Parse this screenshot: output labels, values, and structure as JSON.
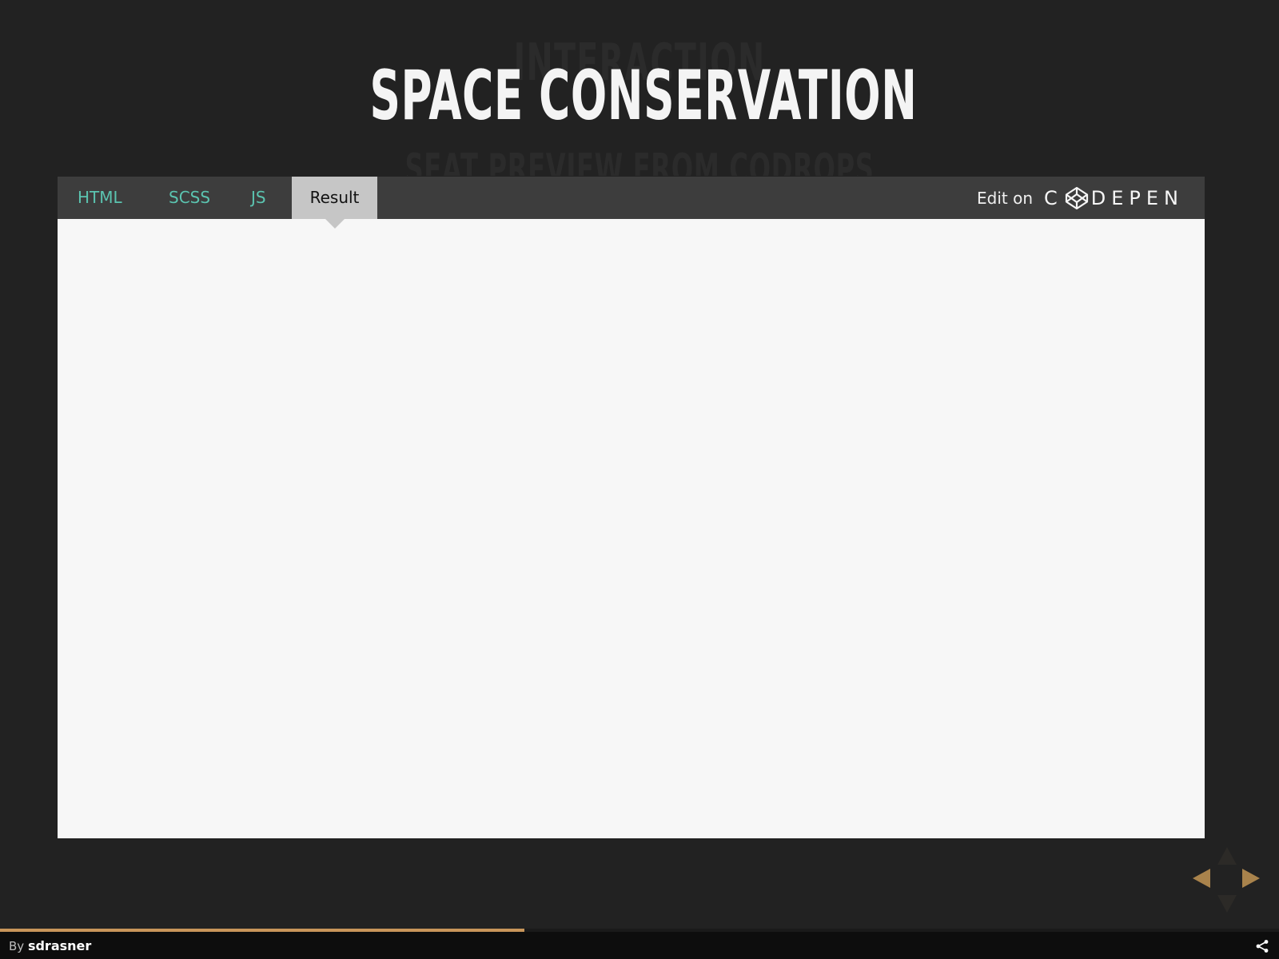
{
  "slide": {
    "ghost_title": "INTERACTION",
    "title": "SPACE CONSERVATION",
    "ghost_subtitle": "SEAT PREVIEW FROM CODROPS"
  },
  "embed": {
    "tabs": [
      {
        "label": "HTML",
        "active": false
      },
      {
        "label": "SCSS",
        "active": false
      },
      {
        "label": "JS",
        "active": false
      },
      {
        "label": "Result",
        "active": true
      }
    ],
    "edit_label": "Edit on",
    "codepen_logo": {
      "letters_before": "C",
      "letters_after": "DEPEN",
      "icon": "codepen-cube-icon"
    },
    "colors": {
      "tab_text": "#5bc4b0",
      "active_tab_bg": "#c6c6c6",
      "tabbar_bg": "#3d3d3d",
      "result_bg": "#f7f7f7"
    }
  },
  "navigation": {
    "arrows": [
      "up",
      "left",
      "right",
      "down"
    ],
    "enabled": {
      "up": false,
      "down": false,
      "left": true,
      "right": true
    },
    "accent_color": "#a9834c"
  },
  "progress": {
    "fraction": 0.41,
    "color": "#c8955a"
  },
  "footer": {
    "by_label": "By",
    "author": "sdrasner",
    "share_icon": "share-icon"
  }
}
